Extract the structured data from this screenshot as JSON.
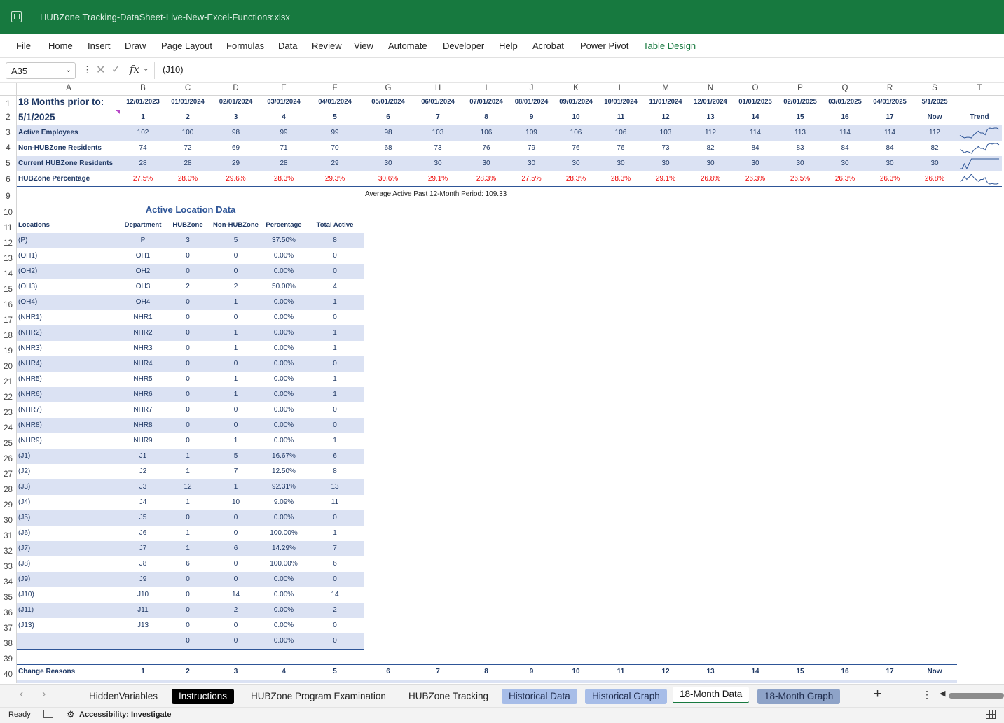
{
  "window": {
    "title": "HUBZone Tracking-DataSheet-Live-New-Excel-Functions.xlsx"
  },
  "menu": [
    "File",
    "Home",
    "Insert",
    "Draw",
    "Page Layout",
    "Formulas",
    "Data",
    "Review",
    "View",
    "Automate",
    "Developer",
    "Help",
    "Acrobat",
    "Power Pivot",
    "Table Design"
  ],
  "formula_bar": {
    "name_box": "A35",
    "formula": "(J10)"
  },
  "columns": [
    "A",
    "B",
    "C",
    "D",
    "E",
    "F",
    "G",
    "H",
    "I",
    "J",
    "K",
    "L",
    "M",
    "N",
    "O",
    "P",
    "Q",
    "R",
    "S",
    "T"
  ],
  "rows": [
    "1",
    "2",
    "3",
    "4",
    "5",
    "6",
    "9",
    "10",
    "11",
    "12",
    "13",
    "14",
    "15",
    "16",
    "17",
    "18",
    "19",
    "20",
    "21",
    "22",
    "23",
    "24",
    "25",
    "26",
    "27",
    "28",
    "29",
    "30",
    "31",
    "32",
    "33",
    "34",
    "35",
    "36",
    "37",
    "38",
    "39",
    "40"
  ],
  "top_table": {
    "title": "18 Months prior to:",
    "date": "5/1/2025",
    "dates": [
      "12/01/2023",
      "01/01/2024",
      "02/01/2024",
      "03/01/2024",
      "04/01/2024",
      "05/01/2024",
      "06/01/2024",
      "07/01/2024",
      "08/01/2024",
      "09/01/2024",
      "10/01/2024",
      "11/01/2024",
      "12/01/2024",
      "01/01/2025",
      "02/01/2025",
      "03/01/2025",
      "04/01/2025",
      "5/1/2025"
    ],
    "indices": [
      "1",
      "2",
      "3",
      "4",
      "5",
      "6",
      "7",
      "8",
      "9",
      "10",
      "11",
      "12",
      "13",
      "14",
      "15",
      "16",
      "17",
      "Now"
    ],
    "trend_label": "Trend",
    "rows": [
      {
        "label": "Active Employees",
        "values": [
          "102",
          "100",
          "98",
          "99",
          "99",
          "98",
          "103",
          "106",
          "109",
          "106",
          "106",
          "103",
          "112",
          "114",
          "113",
          "114",
          "114",
          "112"
        ]
      },
      {
        "label": "Non-HUBZone Residents",
        "values": [
          "74",
          "72",
          "69",
          "71",
          "70",
          "68",
          "73",
          "76",
          "79",
          "76",
          "76",
          "73",
          "82",
          "84",
          "83",
          "84",
          "84",
          "82"
        ]
      },
      {
        "label": "Current HUBZone Residents",
        "values": [
          "28",
          "28",
          "29",
          "28",
          "29",
          "30",
          "30",
          "30",
          "30",
          "30",
          "30",
          "30",
          "30",
          "30",
          "30",
          "30",
          "30",
          "30"
        ]
      },
      {
        "label": "HUBZone Percentage",
        "values": [
          "27.5%",
          "28.0%",
          "29.6%",
          "28.3%",
          "29.3%",
          "30.6%",
          "29.1%",
          "28.3%",
          "27.5%",
          "28.3%",
          "28.3%",
          "29.1%",
          "26.8%",
          "26.3%",
          "26.5%",
          "26.3%",
          "26.3%",
          "26.8%"
        ]
      }
    ],
    "average_note": "Average Active Past 12-Month Period: 109.33"
  },
  "location_table": {
    "title": "Active Location Data",
    "headers": [
      "Locations",
      "Department",
      "HUBZone",
      "Non-HUBZone",
      "Percentage",
      "Total Active"
    ],
    "rows": [
      [
        "(P)",
        "P",
        "3",
        "5",
        "37.50%",
        "8"
      ],
      [
        "(OH1)",
        "OH1",
        "0",
        "0",
        "0.00%",
        "0"
      ],
      [
        "(OH2)",
        "OH2",
        "0",
        "0",
        "0.00%",
        "0"
      ],
      [
        "(OH3)",
        "OH3",
        "2",
        "2",
        "50.00%",
        "4"
      ],
      [
        "(OH4)",
        "OH4",
        "0",
        "1",
        "0.00%",
        "1"
      ],
      [
        "(NHR1)",
        "NHR1",
        "0",
        "0",
        "0.00%",
        "0"
      ],
      [
        "(NHR2)",
        "NHR2",
        "0",
        "1",
        "0.00%",
        "1"
      ],
      [
        "(NHR3)",
        "NHR3",
        "0",
        "1",
        "0.00%",
        "1"
      ],
      [
        "(NHR4)",
        "NHR4",
        "0",
        "0",
        "0.00%",
        "0"
      ],
      [
        "(NHR5)",
        "NHR5",
        "0",
        "1",
        "0.00%",
        "1"
      ],
      [
        "(NHR6)",
        "NHR6",
        "0",
        "1",
        "0.00%",
        "1"
      ],
      [
        "(NHR7)",
        "NHR7",
        "0",
        "0",
        "0.00%",
        "0"
      ],
      [
        "(NHR8)",
        "NHR8",
        "0",
        "0",
        "0.00%",
        "0"
      ],
      [
        "(NHR9)",
        "NHR9",
        "0",
        "1",
        "0.00%",
        "1"
      ],
      [
        "(J1)",
        "J1",
        "1",
        "5",
        "16.67%",
        "6"
      ],
      [
        "(J2)",
        "J2",
        "1",
        "7",
        "12.50%",
        "8"
      ],
      [
        "(J3)",
        "J3",
        "12",
        "1",
        "92.31%",
        "13"
      ],
      [
        "(J4)",
        "J4",
        "1",
        "10",
        "9.09%",
        "11"
      ],
      [
        "(J5)",
        "J5",
        "0",
        "0",
        "0.00%",
        "0"
      ],
      [
        "(J6)",
        "J6",
        "1",
        "0",
        "100.00%",
        "1"
      ],
      [
        "(J7)",
        "J7",
        "1",
        "6",
        "14.29%",
        "7"
      ],
      [
        "(J8)",
        "J8",
        "6",
        "0",
        "100.00%",
        "6"
      ],
      [
        "(J9)",
        "J9",
        "0",
        "0",
        "0.00%",
        "0"
      ],
      [
        "(J10)",
        "J10",
        "0",
        "14",
        "0.00%",
        "14"
      ],
      [
        "(J11)",
        "J11",
        "0",
        "2",
        "0.00%",
        "2"
      ],
      [
        "(J13)",
        "J13",
        "0",
        "0",
        "0.00%",
        "0"
      ],
      [
        "",
        "",
        "0",
        "0",
        "0.00%",
        "0"
      ]
    ]
  },
  "change_reasons": {
    "label": "Change Reasons",
    "indices": [
      "1",
      "2",
      "3",
      "4",
      "5",
      "6",
      "7",
      "8",
      "9",
      "10",
      "11",
      "12",
      "13",
      "14",
      "15",
      "16",
      "17",
      "Now"
    ]
  },
  "sheet_tabs": [
    "HiddenVariables",
    "Instructions",
    "HUBZone Program Examination",
    "HUBZone Tracking",
    "Historical Data",
    "Historical Graph",
    "18-Month Data",
    "18-Month Graph"
  ],
  "active_tab": "18-Month Data",
  "status": {
    "ready": "Ready",
    "accessibility": "Accessibility: Investigate"
  },
  "colors": {
    "excel_green": "#17793f",
    "band": "#dbe2f3",
    "text_blue": "#1f3864",
    "red": "#e00000"
  }
}
